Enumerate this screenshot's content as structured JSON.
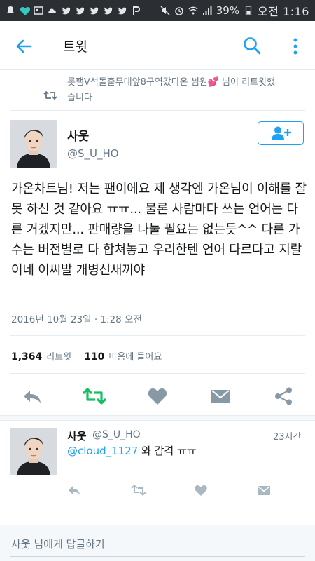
{
  "status_bar": {
    "battery": "39%",
    "time": "오전 1:16"
  },
  "app_bar": {
    "title": "트윗"
  },
  "retweet_banner": {
    "text": "롯팸V석돌출무대앞8구역갔다온 썸원",
    "heart": "💕",
    "suffix": " 님이 리트윗했습니다"
  },
  "tweet": {
    "author_name": "사웃",
    "author_handle": "@S_U_HO",
    "text": "가온차트님! 저는 팬이에요 제 생각엔 가온님이 이해를 잘 못 하신 것 같아요 ㅠㅠ... 물론 사람마다 쓰는 언어는 다른 거겠지만... 판매량을 나눌 필요는 없는듯^^ 다른 가수는 버전별로 다 합쳐놓고 우리한텐 언어 다르다고 지랄이네 이씨발 개병신새끼야",
    "date": "2016년 10월 23일 · 1:28 오전",
    "retweet_count": "1,364",
    "retweet_label": "리트윗",
    "like_count": "110",
    "like_label": "마음에 들어요"
  },
  "reply": {
    "author_name": "사웃",
    "author_handle": "@S_U_HO",
    "time": "23시간",
    "mention": "@cloud_1127",
    "text": " 와 감격 ㅠㅠ"
  },
  "compose": {
    "placeholder": "사웃 님에게 답글하기"
  },
  "colors": {
    "accent": "#1da1f2",
    "retweet_green": "#17bf63",
    "muted": "#657786",
    "icon_gray": "#8899a6"
  }
}
